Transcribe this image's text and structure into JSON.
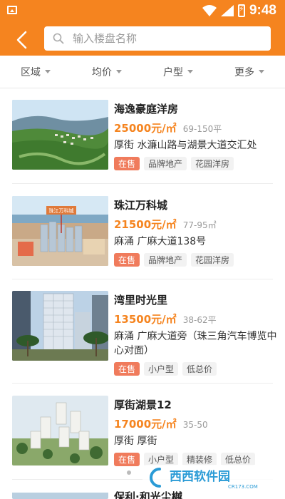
{
  "status_bar": {
    "time": "9:48"
  },
  "search": {
    "placeholder": "输入楼盘名称"
  },
  "filters": [
    {
      "label": "区域"
    },
    {
      "label": "均价"
    },
    {
      "label": "户型"
    },
    {
      "label": "更多"
    }
  ],
  "listings": [
    {
      "name": "海逸豪庭洋房",
      "price": "25000元/㎡",
      "area": "69-150平",
      "address": "厚街 水濂山路与湖景大道交汇处",
      "status": "在售",
      "tags": [
        "品牌地产",
        "花园洋房"
      ]
    },
    {
      "name": "珠江万科城",
      "price": "21500元/㎡",
      "area": "77-95㎡",
      "address": "麻涌 广麻大道138号",
      "status": "在售",
      "tags": [
        "品牌地产",
        "花园洋房"
      ],
      "sign_text": "珠江万科城"
    },
    {
      "name": "湾里时光里",
      "price": "13500元/㎡",
      "area": "38-62平",
      "address": "麻涌 广麻大道旁（珠三角汽车博览中心对面）",
      "status": "在售",
      "tags": [
        "小户型",
        "低总价"
      ]
    },
    {
      "name": "厚街湖景12",
      "price": "17000元/㎡",
      "area": "35-50",
      "address": "厚街 厚街",
      "status": "在售",
      "tags": [
        "小户型",
        "精装修",
        "低总价"
      ]
    },
    {
      "name": "保利·和光尘樾"
    }
  ],
  "watermark": {
    "text": "西西软件园",
    "sub": "CR173.COM"
  },
  "colors": {
    "accent": "#f5841f",
    "sale_tag": "#f07b5c"
  }
}
